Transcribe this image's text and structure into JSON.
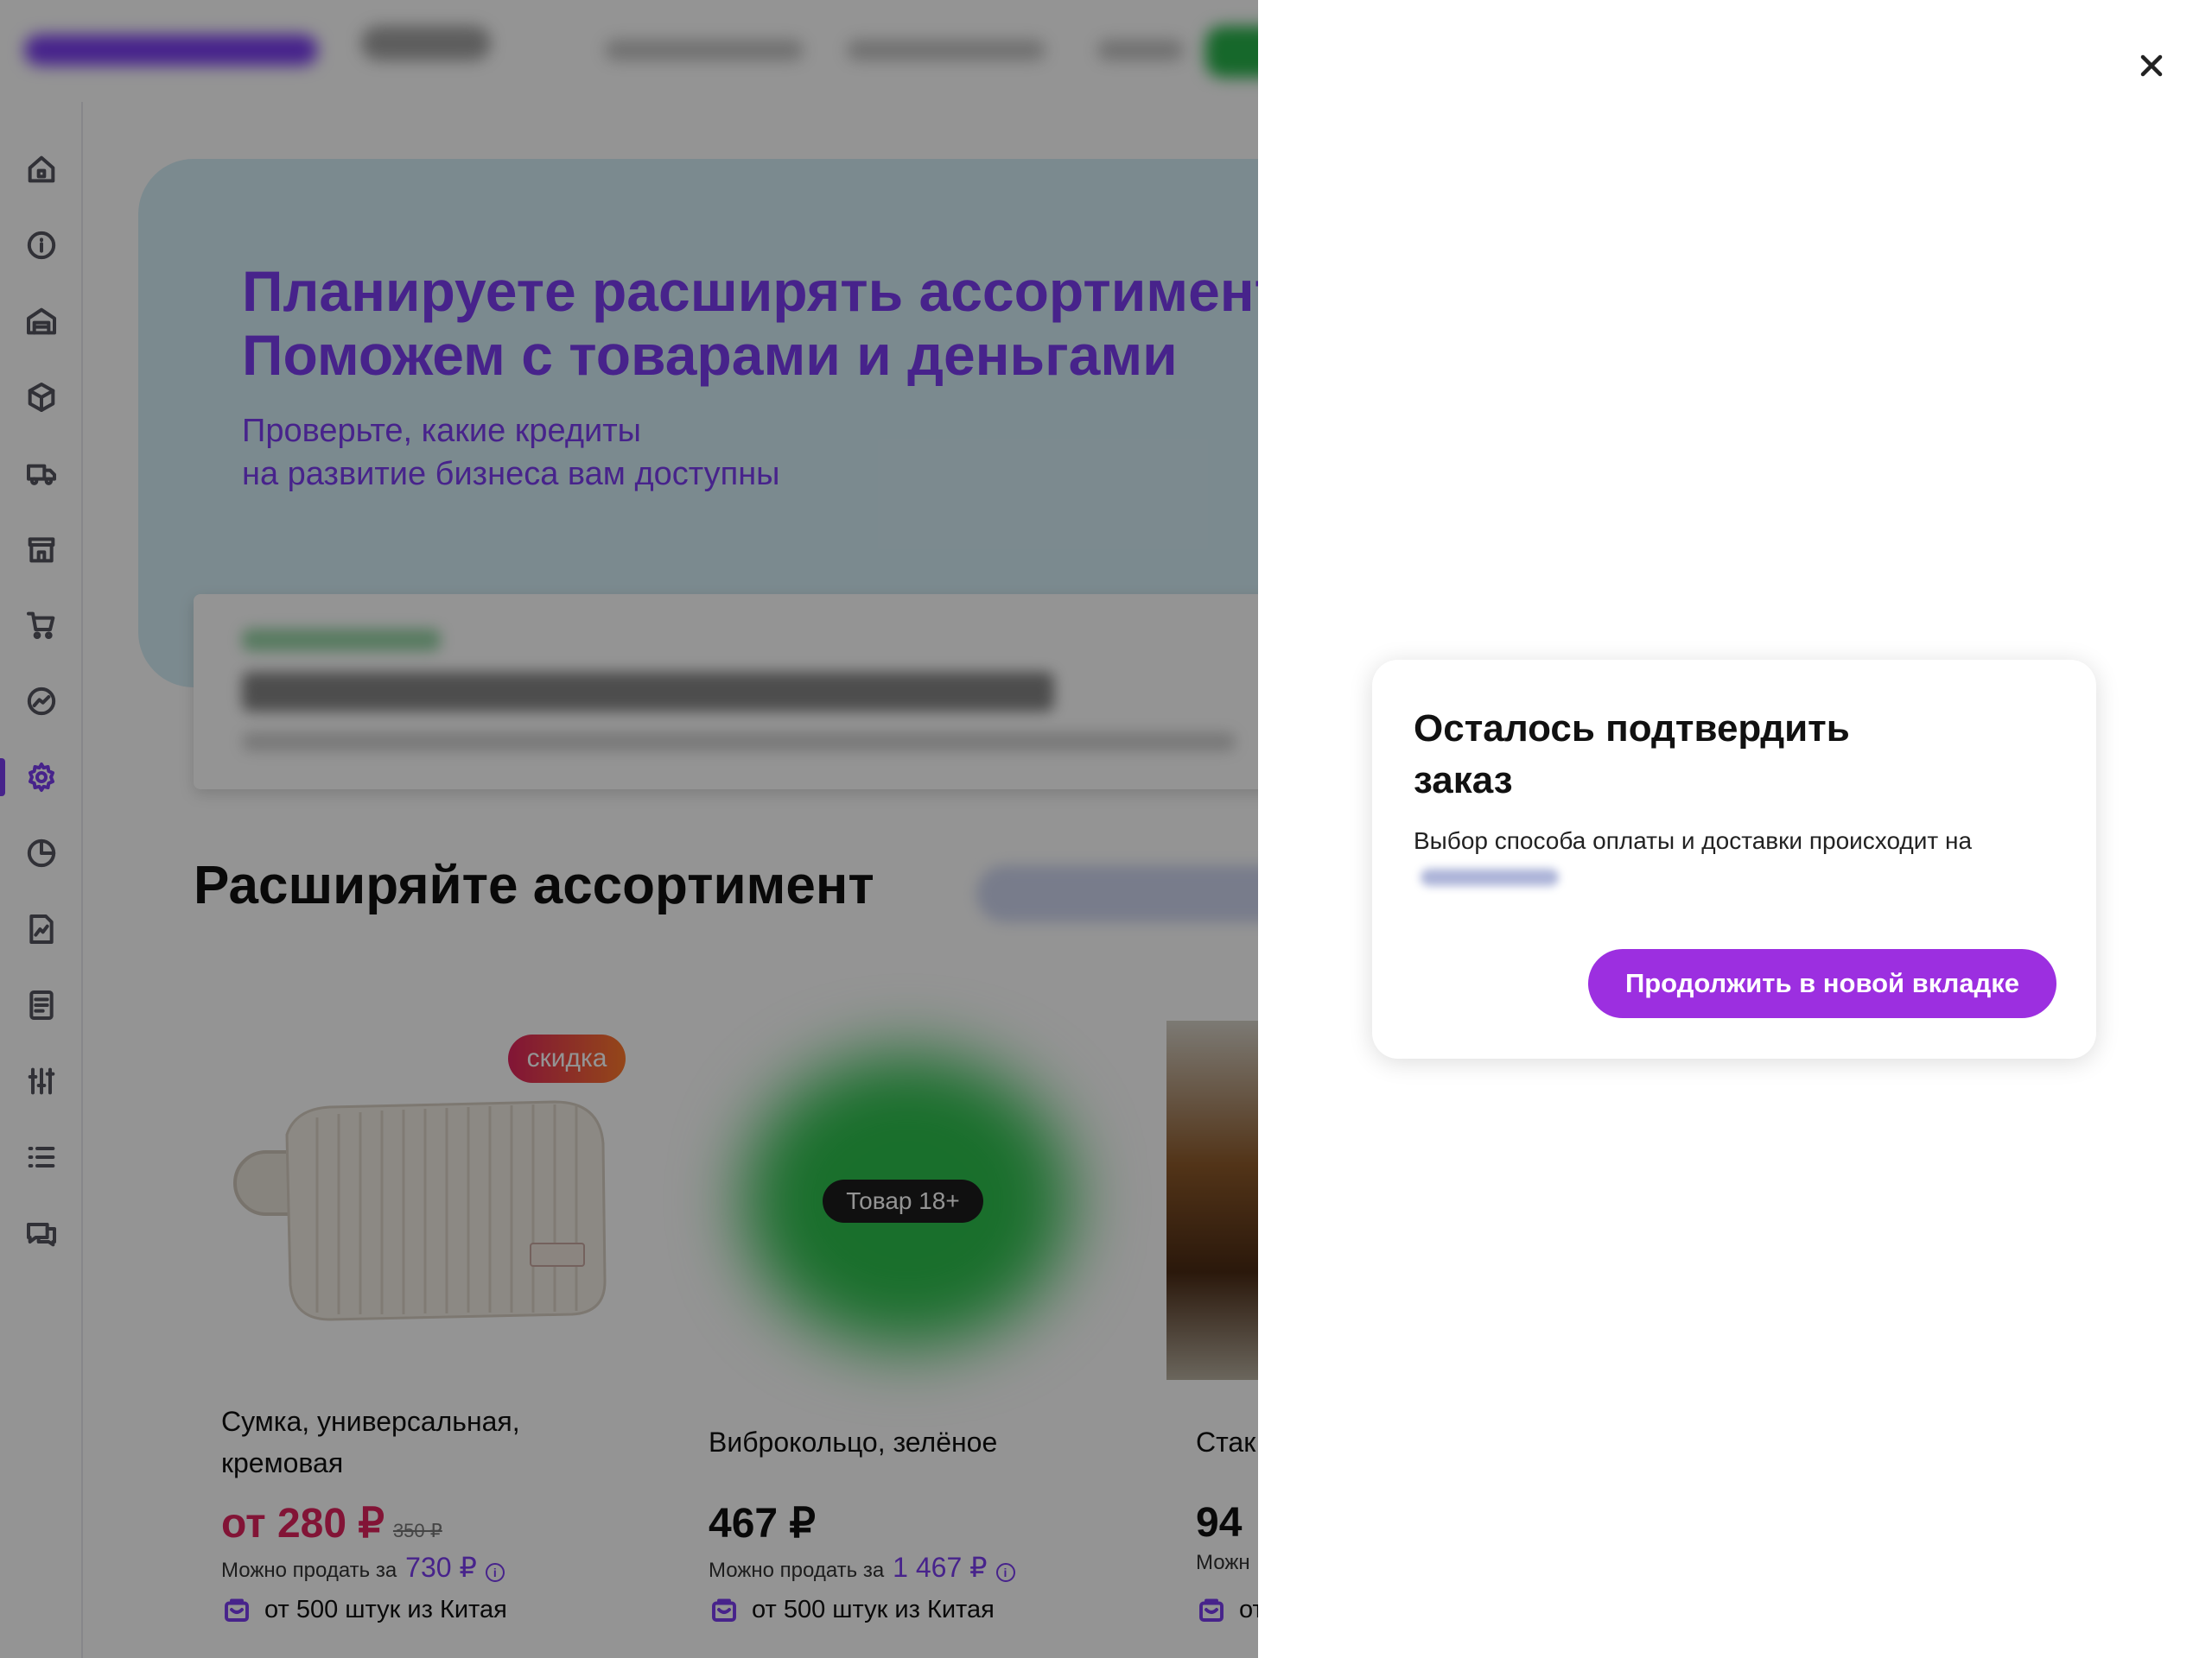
{
  "banner": {
    "title_line1": "Планируете расширять ассортимент?",
    "title_line2": "Поможем с товарами и деньгами",
    "subtitle_line1": "Проверьте, какие кредиты",
    "subtitle_line2": "на развитие бизнеса вам доступны"
  },
  "section": {
    "title": "Расширяйте ассортимент"
  },
  "products": [
    {
      "badge": "скидка",
      "name": "Сумка, универсальная, кремовая",
      "price": "от 280 ₽",
      "old_price": "350 ₽",
      "resale_label": "Можно продать за",
      "resale_value": "730 ₽",
      "origin": "от 500 штук из Китая",
      "colors": {
        "price": "#e0245e"
      }
    },
    {
      "overlay_label": "Товар 18+",
      "name": "Виброкольцо, зелёное",
      "price": "467 ₽",
      "resale_label": "Можно продать за",
      "resale_value": "1 467 ₽",
      "origin": "от 500 штук из Китая"
    },
    {
      "name": "Стак",
      "price": "94",
      "resale_label": "Можн",
      "origin": "от"
    }
  ],
  "sidebar": {
    "icons": [
      "home-icon",
      "info-icon",
      "warehouse-icon",
      "box-icon",
      "truck-icon",
      "store-icon",
      "cart-icon",
      "analytics-icon",
      "gear-icon",
      "pie-chart-icon",
      "report-icon",
      "document-icon",
      "sliders-icon",
      "list-icon",
      "chat-icon"
    ],
    "active": "gear-icon"
  },
  "dialog": {
    "title": "Осталось подтвердить заказ",
    "text": "Выбор способа оплаты и доставки происходит на",
    "button": "Продолжить в новой вкладке",
    "close_icon": "close-icon"
  },
  "colors": {
    "accent": "#7a3df0",
    "button": "#9c2fe0",
    "sale": "#e0245e",
    "banner_bg": "#d5eef6"
  }
}
